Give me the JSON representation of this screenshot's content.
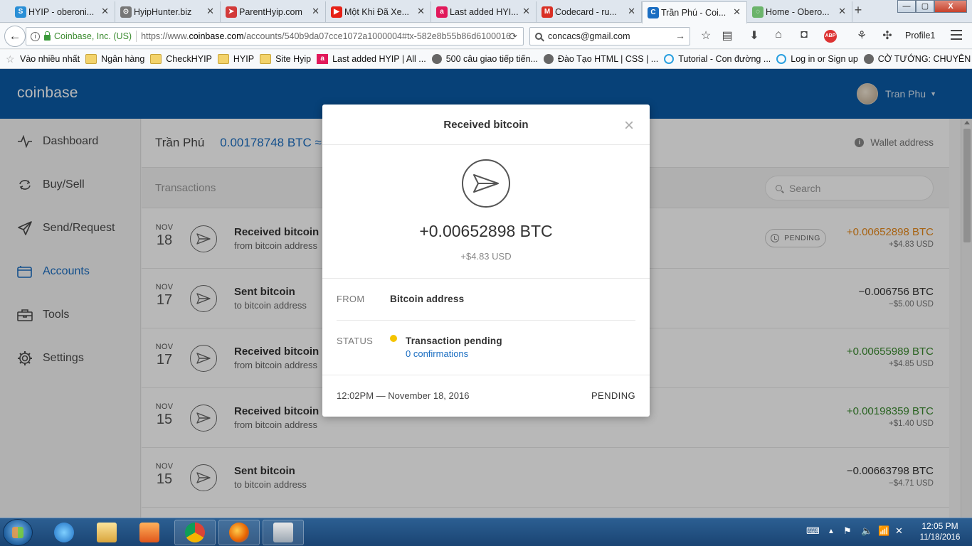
{
  "browser": {
    "tabs": [
      {
        "label": "HYIP - oberoni...",
        "icon": "hyip-icon",
        "color": "#2a8fd6",
        "glyph": "S"
      },
      {
        "label": "HyipHunter.biz",
        "icon": "hunter-icon",
        "color": "#777777",
        "glyph": "⊙"
      },
      {
        "label": "ParentHyip.com",
        "icon": "parenthyip-icon",
        "color": "#d23a3a",
        "glyph": "➤"
      },
      {
        "label": "Một Khi Đã Xe...",
        "icon": "youtube-icon",
        "color": "#e62117",
        "glyph": "▶"
      },
      {
        "label": "Last added HYI...",
        "icon": "allhyip-icon",
        "color": "#e1195b",
        "glyph": "a"
      },
      {
        "label": "Codecard - ru...",
        "icon": "gmail-icon",
        "color": "#d93025",
        "glyph": "M"
      },
      {
        "label": "Trần Phú - Coi...",
        "icon": "coinbase-icon",
        "color": "#1b6ec2",
        "glyph": "C",
        "active": true
      },
      {
        "label": "Home - Obero...",
        "icon": "loading-icon",
        "color": "#6bb46b",
        "glyph": "◌"
      }
    ],
    "new_tab_label": "+",
    "window_controls": {
      "minimize": "—",
      "maximize": "▢",
      "close": "X"
    },
    "url": {
      "org": "Coinbase, Inc. (US)",
      "prefix": "https://www.",
      "domain": "coinbase.com",
      "path": "/accounts/540b9da07cce1072a1000004#tx-582e8b55b86d61000168"
    },
    "search_value": "concacs@gmail.com",
    "profile_label": "Profile1",
    "bookmarks": [
      {
        "label": "Vào nhiều nhất",
        "icon": "star"
      },
      {
        "label": "Ngân hàng",
        "icon": "folder"
      },
      {
        "label": "CheckHYIP",
        "icon": "folder"
      },
      {
        "label": "HYIP",
        "icon": "folder"
      },
      {
        "label": "Site Hyip",
        "icon": "folder"
      },
      {
        "label": "Last added HYIP | All ...",
        "icon": "red"
      },
      {
        "label": "500 câu giao tiếp tiến...",
        "icon": "globe"
      },
      {
        "label": "Đào Tạo HTML | CSS | ...",
        "icon": "globe"
      },
      {
        "label": "Tutorial - Con đường ...",
        "icon": "blue"
      },
      {
        "label": "Log in or Sign up",
        "icon": "blue"
      },
      {
        "label": "CỜ TƯỚNG: CHUYÊN ...",
        "icon": "globe"
      }
    ]
  },
  "coinbase": {
    "logo": "coinbase",
    "user_name": "Tran Phu",
    "nav": [
      {
        "label": "Dashboard",
        "icon": "pulse-icon",
        "active": false
      },
      {
        "label": "Buy/Sell",
        "icon": "refresh-arrows-icon",
        "active": false
      },
      {
        "label": "Send/Request",
        "icon": "paper-plane-icon",
        "active": false
      },
      {
        "label": "Accounts",
        "icon": "wallet-icon",
        "active": true
      },
      {
        "label": "Tools",
        "icon": "toolbox-icon",
        "active": false
      },
      {
        "label": "Settings",
        "icon": "gear-icon",
        "active": false
      }
    ],
    "account": {
      "name": "Trần Phú",
      "balance": "0.00178748 BTC ≈",
      "wallet_address_label": "Wallet address"
    },
    "transactions_label": "Transactions",
    "search_placeholder": "Search",
    "transactions": [
      {
        "month": "NOV",
        "day": "18",
        "title": "Received bitcoin",
        "subtitle": "from bitcoin address",
        "amount": "+0.00652898 BTC",
        "usd": "+$4.83 USD",
        "status": "PENDING",
        "color": "#e8891a"
      },
      {
        "month": "NOV",
        "day": "17",
        "title": "Sent bitcoin",
        "subtitle": "to bitcoin address",
        "amount": "−0.006756 BTC",
        "usd": "−$5.00 USD",
        "status": "",
        "color": "#333333"
      },
      {
        "month": "NOV",
        "day": "17",
        "title": "Received bitcoin",
        "subtitle": "from bitcoin address",
        "amount": "+0.00655989 BTC",
        "usd": "+$4.85 USD",
        "status": "",
        "color": "#3a8a2e"
      },
      {
        "month": "NOV",
        "day": "15",
        "title": "Received bitcoin",
        "subtitle": "from bitcoin address",
        "amount": "+0.00198359 BTC",
        "usd": "+$1.40 USD",
        "status": "",
        "color": "#3a8a2e"
      },
      {
        "month": "NOV",
        "day": "15",
        "title": "Sent bitcoin",
        "subtitle": "to bitcoin address",
        "amount": "−0.00663798 BTC",
        "usd": "−$4.71 USD",
        "status": "",
        "color": "#333333"
      }
    ]
  },
  "modal": {
    "title": "Received bitcoin",
    "close_label": "×",
    "amount": "+0.00652898 BTC",
    "usd": "+$4.83 USD",
    "from_label": "FROM",
    "from_value": "Bitcoin address",
    "status_label": "STATUS",
    "status_value": "Transaction pending",
    "confirmations": "0 confirmations",
    "timestamp": "12:02PM — November 18, 2016",
    "footer_status": "PENDING",
    "status_color": "#f5c400"
  },
  "taskbar": {
    "apps": [
      "ie-icon",
      "explorer-icon",
      "media-player-icon",
      "chrome-icon",
      "firefox-icon",
      "calculator-icon"
    ],
    "time": "12:05 PM",
    "date": "11/18/2016"
  }
}
